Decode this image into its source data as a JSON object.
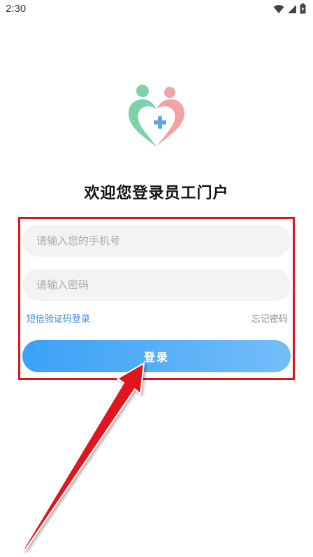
{
  "status_bar": {
    "time": "2:30",
    "icons": [
      "wifi-icon",
      "signal-icon",
      "battery-icon"
    ]
  },
  "logo": {
    "icon": "healthcare-heart-logo",
    "colors": {
      "left": "#7dd3a8",
      "right": "#f2a3a3",
      "cross": "#5aa9e6"
    }
  },
  "page": {
    "title": "欢迎您登录员工门户"
  },
  "form": {
    "phone_placeholder": "请输入您的手机号",
    "phone_value": "",
    "password_placeholder": "请输入密码",
    "password_value": "",
    "sms_login_label": "短信验证码登录",
    "forgot_password_label": "忘记密码",
    "login_label": "登录"
  },
  "annotation": {
    "highlight_color": "#e0141e"
  }
}
